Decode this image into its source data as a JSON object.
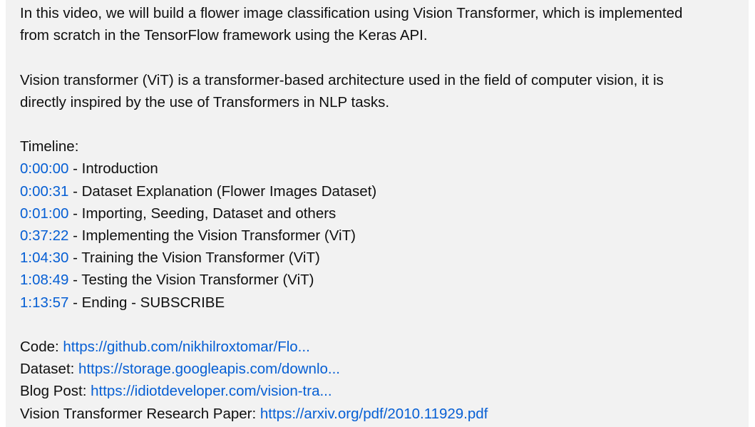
{
  "description": {
    "intro_lines": [
      "In this video, we will build a flower image classification using Vision Transformer, which is implemented",
      "from scratch in the TensorFlow framework using the Keras API."
    ],
    "vit_lines": [
      "Vision transformer (ViT) is a transformer-based architecture used in the field of computer vision, it is",
      "directly inspired by the use of Transformers in NLP tasks."
    ],
    "timeline_heading": "Timeline:",
    "timeline": [
      {
        "time": "0:00:00",
        "label": " - Introduction"
      },
      {
        "time": "0:00:31",
        "label": " - Dataset Explanation (Flower Images Dataset)"
      },
      {
        "time": "0:01:00",
        "label": " - Importing, Seeding, Dataset and others"
      },
      {
        "time": "0:37:22",
        "label": " - Implementing the Vision Transformer (ViT)"
      },
      {
        "time": "1:04:30",
        "label": " - Training the Vision Transformer (ViT)"
      },
      {
        "time": "1:08:49",
        "label": " - Testing the Vision Transformer (ViT)"
      },
      {
        "time": "1:13:57",
        "label": " - Ending - SUBSCRIBE"
      }
    ],
    "links": [
      {
        "label": "Code: ",
        "url": "https://github.com/nikhilroxtomar/Flo..."
      },
      {
        "label": "Dataset: ",
        "url": "https://storage.googleapis.com/downlo..."
      },
      {
        "label": "Blog Post: ",
        "url": "https://idiotdeveloper.com/vision-tra..."
      },
      {
        "label": "Vision Transformer Research Paper: ",
        "url": "https://arxiv.org/pdf/2010.11929.pdf"
      }
    ]
  },
  "colors": {
    "background": "#f2f2f2",
    "text": "#0f0f0f",
    "link": "#065fd4"
  }
}
